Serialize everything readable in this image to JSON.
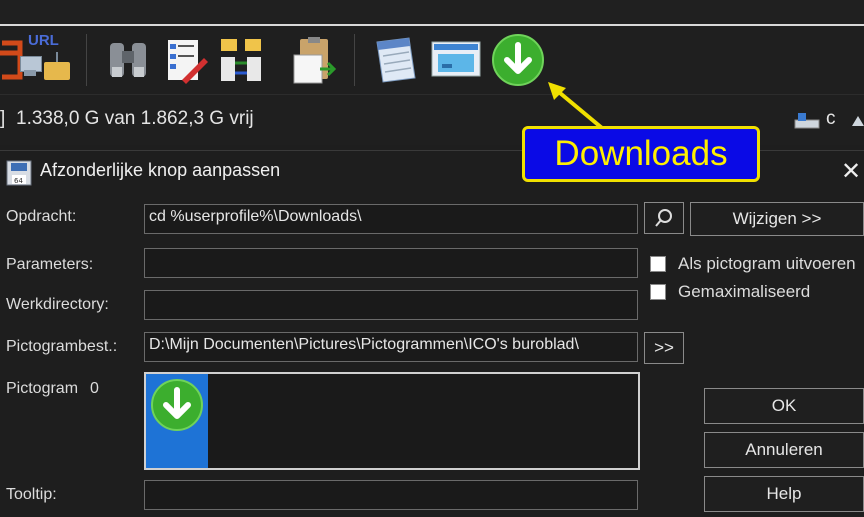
{
  "toolbar": {
    "url_label": "URL",
    "buttons": [
      "refresh-icon",
      "url-network-icon",
      "binoculars-icon",
      "edit-list-icon",
      "sync-folders-icon",
      "paste-document-icon",
      "notepad-icon",
      "control-panel-icon",
      "downloads-icon"
    ]
  },
  "status": {
    "bracket": "]",
    "free_space": "1.338,0 G van 1.862,3 G vrij",
    "drive": "c"
  },
  "callout": {
    "text": "Downloads",
    "color": "#ffef00",
    "bg": "#0a0ae6"
  },
  "dialog": {
    "title": "Afzonderlijke knop aanpassen",
    "close": "✕",
    "labels": {
      "command": "Opdracht:",
      "parameters": "Parameters:",
      "workdir": "Werkdirectory:",
      "iconfile": "Pictogrambest.:",
      "icon": "Pictogram",
      "icon_index": "0",
      "tooltip": "Tooltip:"
    },
    "values": {
      "command": "cd %userprofile%\\Downloads\\",
      "parameters": "",
      "workdir": "",
      "iconfile": "D:\\Mijn Documenten\\Pictures\\Pictogrammen\\ICO's buroblad\\",
      "tooltip": ""
    },
    "buttons": {
      "change": "Wijzigen >>",
      "browse": ">>",
      "ok": "OK",
      "cancel": "Annuleren",
      "help": "Help"
    },
    "checkboxes": {
      "run_as_icon": "Als pictogram uitvoeren",
      "maximized": "Gemaximaliseerd"
    }
  },
  "colors": {
    "icon_selected": "#1e73d6",
    "download_green": "#2aa52a"
  }
}
